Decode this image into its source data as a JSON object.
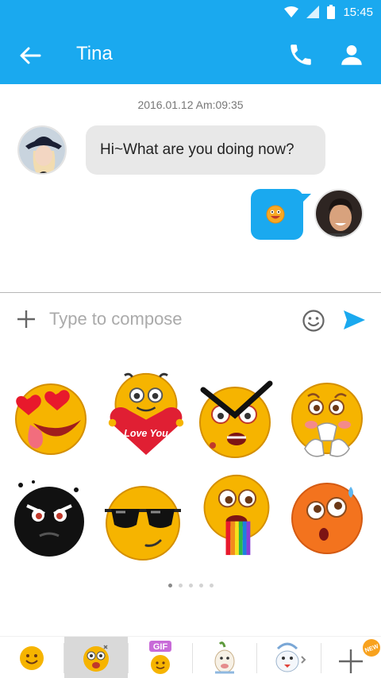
{
  "status_bar": {
    "time": "15:45"
  },
  "header": {
    "title": "Tina"
  },
  "conversation": {
    "timestamp": "2016.01.12 Am:09:35",
    "incoming_message": "Hi~What are you doing now?"
  },
  "compose": {
    "placeholder": "Type to compose"
  },
  "sticker_panel": {
    "stickers": [
      "heart-eyes",
      "love-you-heart",
      "angry-brows",
      "scared",
      "black-ninja",
      "sunglasses",
      "rainbow-vomit",
      "surprised-sweat"
    ],
    "love_you_text": "Love You",
    "pages": 5,
    "active_page": 1
  },
  "tabs": {
    "gif_label": "GIF",
    "new_badge": "NEW"
  },
  "colors": {
    "primary": "#1aa9ef",
    "incoming_bubble": "#e8e8e8",
    "timestamp": "#777777"
  }
}
